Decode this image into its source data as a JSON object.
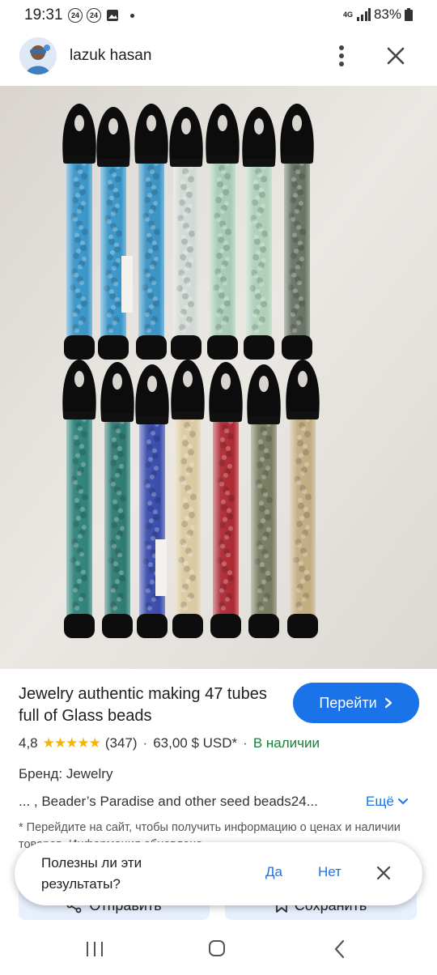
{
  "status_bar": {
    "time": "19:31",
    "badge_1": "24",
    "badge_2": "24",
    "network": "4G",
    "battery": "83%"
  },
  "header": {
    "title": "lazuk hasan",
    "icons": [
      "avatar",
      "more-vert-icon",
      "close-icon"
    ]
  },
  "product": {
    "title": "Jewelry authentic making 47 tubes full of Glass beads",
    "go_button": "Перейти",
    "rating": "4,8",
    "stars": "★★★★★",
    "reviews": "(347)",
    "price": "63,00 $ USD*",
    "stock": "В наличии",
    "brand": "Бренд: Jewelry",
    "description": "... , Beader’s Paradise and other seed beads24...",
    "more": "Ещё",
    "note": "* Перейдите на сайт, чтобы получить информацию о ценах и наличии товаров. Информация обновлена"
  },
  "actions": {
    "share": "Отправить",
    "save": "Сохранить"
  },
  "feedback": {
    "question": "Полезны ли эти результаты?",
    "yes": "Да",
    "no": "Нет"
  },
  "colors": {
    "accent": "#1a73e8",
    "stock_green": "#188038",
    "star": "#f4b400"
  },
  "photo": {
    "tubes_top_row": [
      "#2a8fc8",
      "#2a8fc8",
      "#2b8cc2",
      "#cfd8d2",
      "#9fc9b0",
      "#a9cdb5",
      "#5e6a5a"
    ],
    "tubes_bottom_row": [
      "#1f7a72",
      "#1d7268",
      "#2a3fa8",
      "#d9c79c",
      "#a81a24",
      "#6f7456",
      "#bfa878"
    ]
  }
}
